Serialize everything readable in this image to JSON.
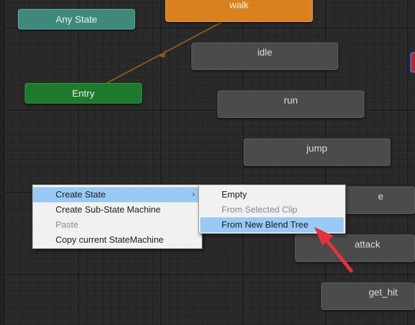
{
  "states": {
    "any": "Any State",
    "entry": "Entry",
    "walk": "walk",
    "idle": "idle",
    "run": "run",
    "jump": "jump",
    "partial": "e",
    "attack": "attack",
    "get_hit": "get_hit"
  },
  "context_menu": {
    "items": [
      {
        "label": "Create State",
        "has_submenu": true
      },
      {
        "label": "Create Sub-State Machine"
      },
      {
        "label": "Paste",
        "disabled": true
      },
      {
        "label": "Copy current StateMachine"
      }
    ],
    "submenu_arrow": "›"
  },
  "submenu": {
    "items": [
      {
        "label": "Empty"
      },
      {
        "label": "From Selected Clip",
        "disabled": true
      },
      {
        "label": "From New Blend Tree",
        "highlighted": true
      }
    ]
  },
  "colors": {
    "default_state": "#d9801f",
    "any_state": "#3d8a7d",
    "entry_state": "#1e7a2c",
    "transition_line": "#8a5a12",
    "highlight": "#99c9f5",
    "annotation_arrow": "#e8323a"
  },
  "icons": {
    "submenu_indicator": "chevron-right-icon",
    "annotation": "red-pointer-arrow-icon"
  }
}
